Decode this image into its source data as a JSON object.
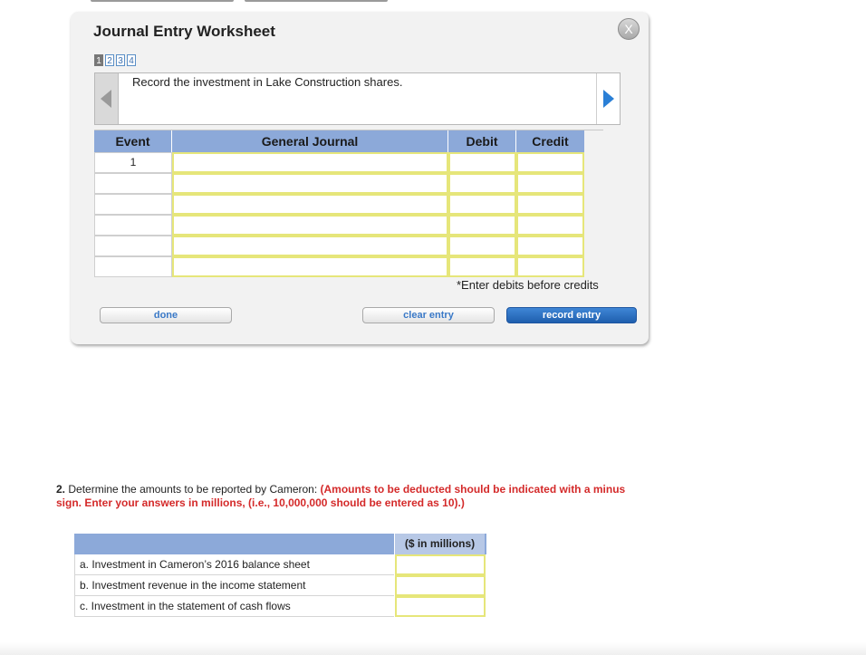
{
  "worksheet": {
    "title": "Journal Entry Worksheet",
    "close_label": "X",
    "pages": [
      "1",
      "2",
      "3",
      "4"
    ],
    "instruction": "Record the investment in Lake Construction shares.",
    "columns": {
      "event": "Event",
      "general_journal": "General Journal",
      "debit": "Debit",
      "credit": "Credit"
    },
    "rows": [
      {
        "event": "1"
      },
      {
        "event": ""
      },
      {
        "event": ""
      },
      {
        "event": ""
      },
      {
        "event": ""
      },
      {
        "event": ""
      }
    ],
    "note": "*Enter debits before credits",
    "buttons": {
      "done": "done",
      "clear": "clear entry",
      "record": "record entry"
    }
  },
  "question2": {
    "number": "2.",
    "text": "Determine the amounts to be reported by Cameron:",
    "instruction_red": "(Amounts to be deducted should be indicated with a minus sign. Enter your answers in millions, (i.e., 10,000,000 should be entered as 10).)",
    "column_header": "($ in millions)",
    "rows": [
      {
        "label": "a. Investment in Cameron’s 2016 balance sheet"
      },
      {
        "label": "b. Investment revenue in the income statement"
      },
      {
        "label": "c. Investment in the statement of cash flows"
      }
    ]
  },
  "colors": {
    "header_blue": "#8ca9d9",
    "input_border": "#e6e67a",
    "accent_blue": "#2a7fd6",
    "instruction_red": "#d42a2a"
  }
}
